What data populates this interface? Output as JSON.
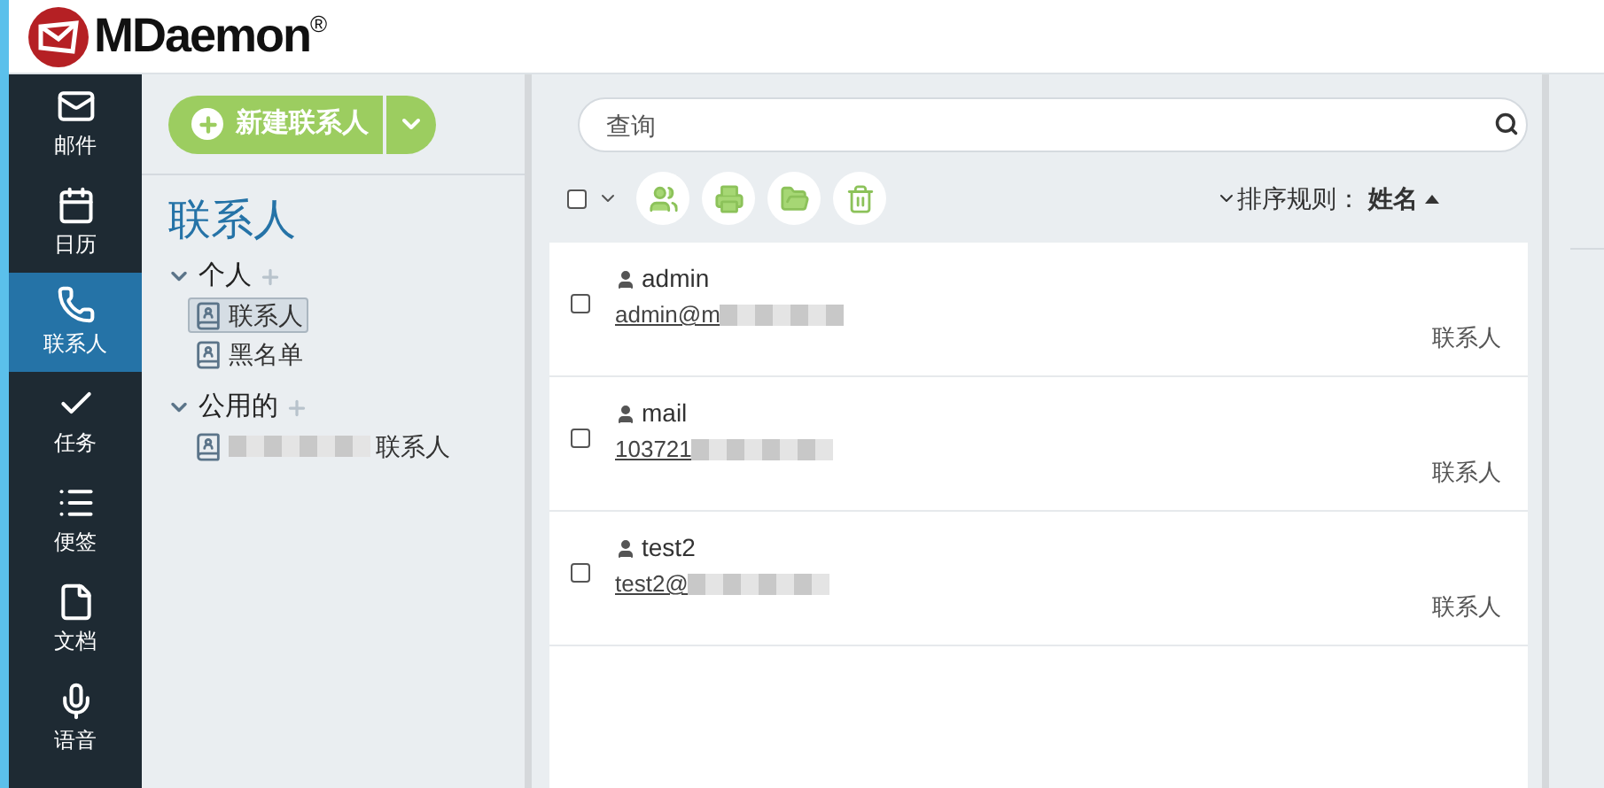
{
  "brand": {
    "name": "MDaemon",
    "mark": "®"
  },
  "nav": [
    {
      "label": "邮件",
      "selected": false
    },
    {
      "label": "日历",
      "selected": false
    },
    {
      "label": "联系人",
      "selected": true
    },
    {
      "label": "任务",
      "selected": false
    },
    {
      "label": "便签",
      "selected": false
    },
    {
      "label": "文档",
      "selected": false
    },
    {
      "label": "语音",
      "selected": false
    }
  ],
  "new_button": {
    "label": "新建联系人"
  },
  "folders_title": "联系人",
  "folder_groups": [
    {
      "label": "个人",
      "expanded": true,
      "children": [
        {
          "label": "联系人",
          "selected": true,
          "redacted": false
        },
        {
          "label": "黑名单",
          "selected": false,
          "redacted": false
        }
      ]
    },
    {
      "label": "公用的",
      "expanded": true,
      "children": [
        {
          "label": "联系人",
          "selected": false,
          "redacted": true
        }
      ]
    }
  ],
  "search": {
    "placeholder": "查询"
  },
  "select_all": {
    "checked": false
  },
  "sort": {
    "label": "排序规则：",
    "value": "姓名"
  },
  "contacts": [
    {
      "name": "admin",
      "email": "admin@m",
      "type": "联系人",
      "checked": false
    },
    {
      "name": "mail",
      "email": "103721",
      "type": "联系人",
      "checked": false
    },
    {
      "name": "test2",
      "email": "test2@",
      "type": "联系人",
      "checked": false
    }
  ]
}
